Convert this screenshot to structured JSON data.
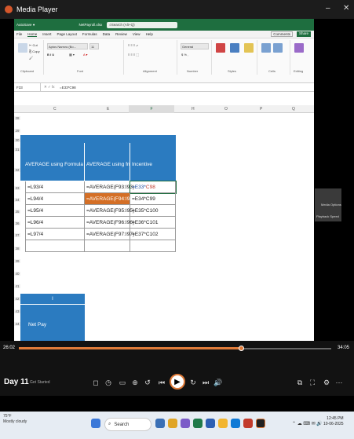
{
  "player": {
    "title": "Media Player",
    "minimize": "–",
    "close": "✕",
    "elapsed": "26:02",
    "duration": "34:05",
    "progress_fraction": 0.71,
    "day_label": "Day 11",
    "footer_text": "Get Started"
  },
  "excel": {
    "file_name": "NetPayroll.xlsx",
    "search_placeholder": "Search (Alt+Q)",
    "user_name": "",
    "menu": [
      "File",
      "Home",
      "Insert",
      "Page Layout",
      "Formulas",
      "Data",
      "Review",
      "View",
      "Help"
    ],
    "active_menu": "Home",
    "comments_label": "Comments",
    "share_label": "Share",
    "name_box": "F33",
    "formula": "=E33*C98",
    "ribbon": {
      "font_name": "Aptos Narrow (Bo...",
      "font_size": "11",
      "number_format": "General",
      "groups": [
        "Clipboard",
        "Font",
        "Alignment",
        "Number",
        "Styles",
        "Cells",
        "Editing"
      ]
    },
    "columns": [
      "C",
      "E",
      "F",
      "H",
      "O",
      "P",
      "Q"
    ],
    "selected_column": "F",
    "rows": [
      "28",
      "29",
      "30",
      "31",
      "32",
      "33",
      "34",
      "35",
      "36",
      "37",
      "38",
      "39",
      "40",
      "41",
      "42",
      "43",
      "44"
    ],
    "table": {
      "headers": [
        "AVERAGE using Formula",
        "AVERAGE using fn",
        "Incentive"
      ],
      "data": [
        [
          "=L93/4",
          "=AVERAGE(F93:I93)",
          "=E33*C98"
        ],
        [
          "=L94/4",
          "=AVERAGE(F94:I94)",
          "=E34*C99"
        ],
        [
          "=L95/4",
          "=AVERAGE(F95:I95)",
          "=E35*C100"
        ],
        [
          "=L96/4",
          "=AVERAGE(F96:I96)",
          "=E36*C101"
        ],
        [
          "=L97/4",
          "=AVERAGE(F97:I97)",
          "=E37*C102"
        ]
      ]
    },
    "lower": {
      "header_top": "I",
      "net_pay": "Net Pay"
    },
    "sheet_tabs": [
      "Sheet1",
      "Salary",
      "Sales",
      "Attendance",
      "Data",
      "Result",
      "Emp"
    ]
  },
  "side_overlay": {
    "line1": "Media Options",
    "line2": "Playback Speed"
  },
  "taskbar": {
    "weather_temp": "75°F",
    "weather_desc": "Mostly cloudy",
    "search_label": "Search",
    "time": "12:45 PM",
    "date": "10-06-2025"
  },
  "colors": {
    "accent_orange": "#e07b39",
    "header_blue": "#2b7bc0",
    "excel_green": "#1e6e3f"
  }
}
